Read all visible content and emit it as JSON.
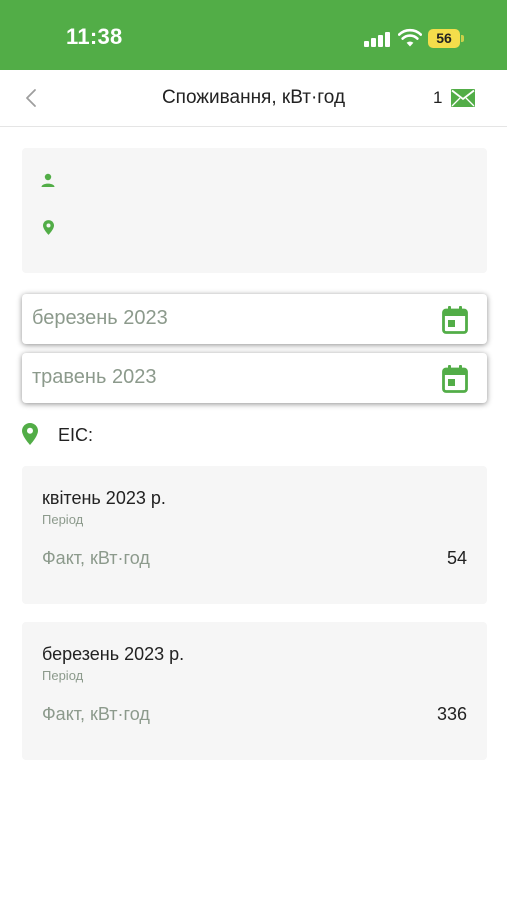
{
  "status_bar": {
    "time": "11:38",
    "battery": "56"
  },
  "header": {
    "title": "Споживання, кВт·год",
    "message_count": "1"
  },
  "filters": {
    "date_from": "березень 2023",
    "date_to": "травень 2023"
  },
  "eic": {
    "label": "EIC:"
  },
  "records": [
    {
      "period": "квітень 2023 р.",
      "period_caption": "Період",
      "fact_label": "Факт, кВт·год",
      "fact_value": "54"
    },
    {
      "period": "березень 2023 р.",
      "period_caption": "Період",
      "fact_label": "Факт, кВт·год",
      "fact_value": "336"
    }
  ],
  "colors": {
    "brand_green": "#52ad47",
    "card_background": "#f6f6f6",
    "muted_text": "#8c9a8c"
  }
}
